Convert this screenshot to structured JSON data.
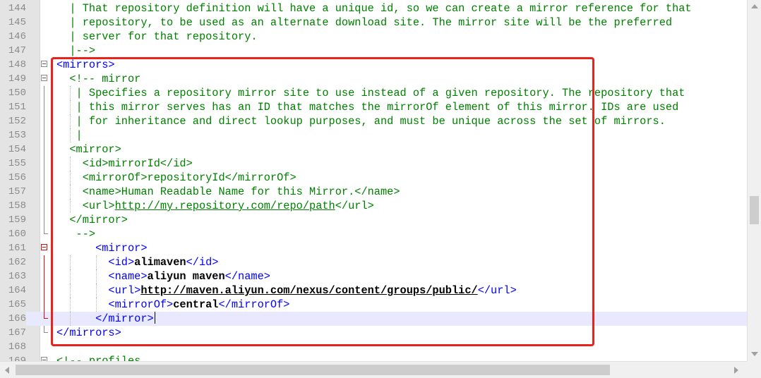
{
  "editor": {
    "highlight_color": "#e8231c",
    "syntax_colors": {
      "comment": "#008000",
      "tag": "#0000ff",
      "text": "#000000",
      "current_line": "#e8e8ff"
    },
    "lines": [
      {
        "num": "144",
        "segs": [
          [
            "c",
            "  | That repository definition will have a unique id, so we can create a mirror reference for that"
          ]
        ]
      },
      {
        "num": "145",
        "segs": [
          [
            "c",
            "  | repository, to be used as an alternate download site. The mirror site will be the preferred"
          ]
        ]
      },
      {
        "num": "146",
        "segs": [
          [
            "c",
            "  | server for that repository."
          ]
        ]
      },
      {
        "num": "147",
        "segs": [
          [
            "c",
            "  |-->"
          ]
        ]
      },
      {
        "num": "148",
        "fold": "box",
        "segs": [
          [
            "t",
            "<mirrors>"
          ]
        ]
      },
      {
        "num": "149",
        "fold": "box",
        "segs": [
          [
            "c",
            "  <!-- mirror"
          ]
        ]
      },
      {
        "num": "150",
        "fold": "line",
        "segs": [
          [
            "c",
            "   | Specifies a repository mirror site to use instead of a given repository. The repository that"
          ]
        ]
      },
      {
        "num": "151",
        "fold": "line",
        "segs": [
          [
            "c",
            "   | this mirror serves has an ID that matches the mirrorOf element of this mirror. IDs are used"
          ]
        ]
      },
      {
        "num": "152",
        "fold": "line",
        "segs": [
          [
            "c",
            "   | for inheritance and direct lookup purposes, and must be unique across the set of mirrors."
          ]
        ]
      },
      {
        "num": "153",
        "fold": "line",
        "segs": [
          [
            "c",
            "   |"
          ]
        ]
      },
      {
        "num": "154",
        "fold": "line",
        "segs": [
          [
            "c",
            "  <mirror>"
          ]
        ]
      },
      {
        "num": "155",
        "fold": "line",
        "segs": [
          [
            "c",
            "    <id>mirrorId</id>"
          ]
        ]
      },
      {
        "num": "156",
        "fold": "line",
        "segs": [
          [
            "c",
            "    <mirrorOf>repositoryId</mirrorOf>"
          ]
        ]
      },
      {
        "num": "157",
        "fold": "line",
        "segs": [
          [
            "c",
            "    <name>Human Readable Name for this Mirror.</name>"
          ]
        ]
      },
      {
        "num": "158",
        "fold": "line",
        "segs": [
          [
            "c",
            "    <url>"
          ],
          [
            "u",
            "http://my.repository.com/repo/path"
          ],
          [
            "c",
            "</url>"
          ]
        ]
      },
      {
        "num": "159",
        "fold": "line",
        "segs": [
          [
            "c",
            "  </mirror>"
          ]
        ]
      },
      {
        "num": "160",
        "fold": "end",
        "segs": [
          [
            "c",
            "   -->"
          ]
        ]
      },
      {
        "num": "161",
        "fold": "box-red",
        "segs": [
          [
            "t",
            "      <mirror>"
          ]
        ]
      },
      {
        "num": "162",
        "fold": "line-red",
        "segs": [
          [
            "t",
            "        <id>"
          ],
          [
            "tx",
            "alimaven"
          ],
          [
            "t",
            "</id>"
          ]
        ]
      },
      {
        "num": "163",
        "fold": "line-red",
        "segs": [
          [
            "t",
            "        <name>"
          ],
          [
            "tx",
            "aliyun maven"
          ],
          [
            "t",
            "</name>"
          ]
        ]
      },
      {
        "num": "164",
        "fold": "line-red",
        "segs": [
          [
            "t",
            "        <url>"
          ],
          [
            "bu",
            "http://maven.aliyun.com/nexus/content/groups/public/"
          ],
          [
            "t",
            "</url>"
          ]
        ]
      },
      {
        "num": "165",
        "fold": "line-red",
        "segs": [
          [
            "t",
            "        <mirrorOf>"
          ],
          [
            "tx",
            "central"
          ],
          [
            "t",
            "</mirrorOf>"
          ]
        ]
      },
      {
        "num": "166",
        "fold": "end-red",
        "current": true,
        "caret": true,
        "segs": [
          [
            "t",
            "      </mirror>"
          ]
        ]
      },
      {
        "num": "167",
        "fold": "end",
        "segs": [
          [
            "t",
            "</mirrors>"
          ]
        ]
      },
      {
        "num": "168",
        "segs": [
          [
            "c",
            ""
          ]
        ]
      },
      {
        "num": "169",
        "fold": "box",
        "segs": [
          [
            "c",
            "<!-- profiles"
          ]
        ]
      }
    ]
  }
}
